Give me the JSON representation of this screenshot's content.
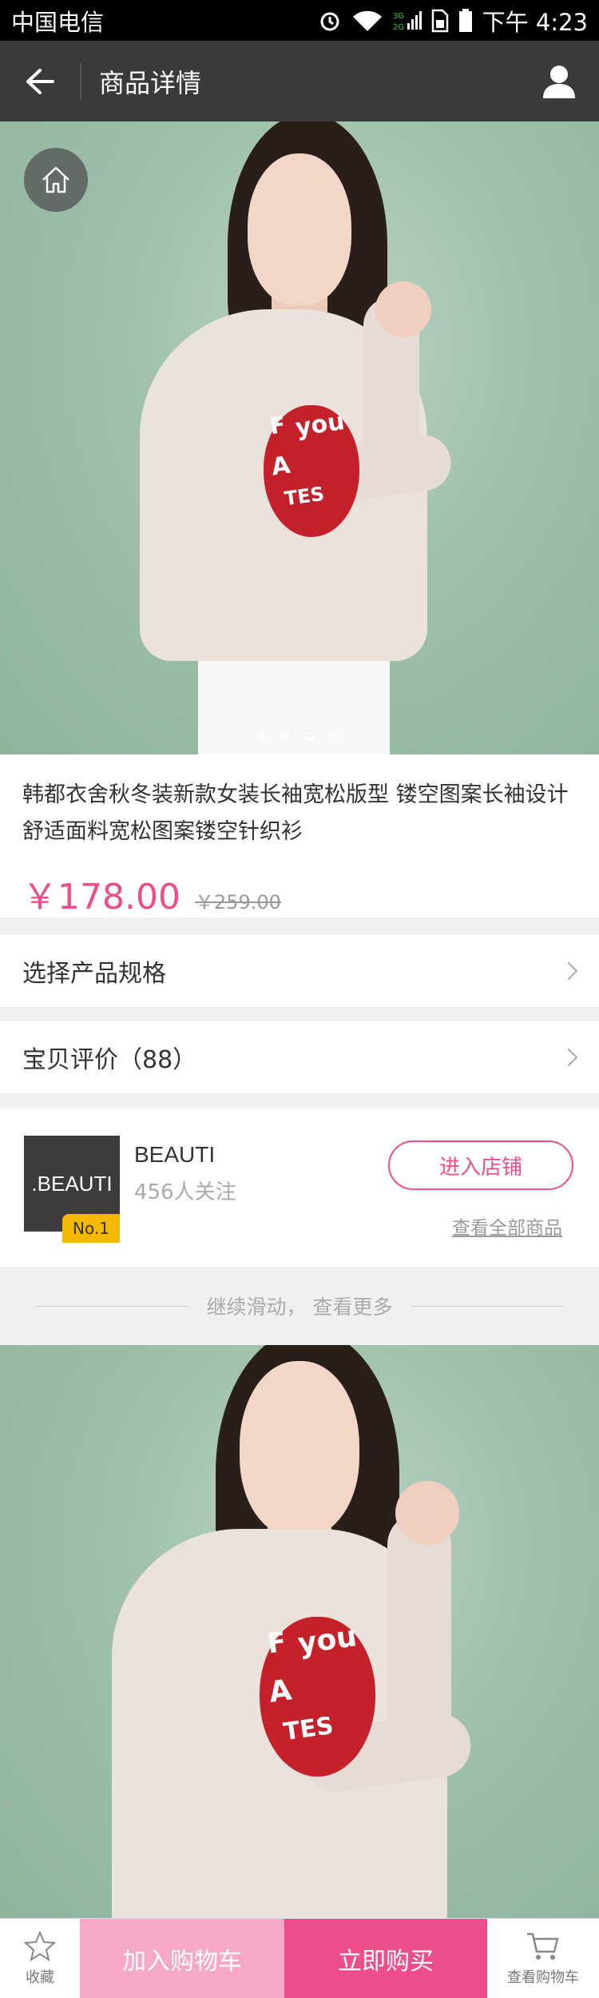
{
  "status_bar": {
    "carrier": "中国电信",
    "time": "下午 4:23",
    "icons": [
      "alarm-icon",
      "wifi-icon",
      "signal-icon",
      "sim-icon",
      "battery-icon"
    ]
  },
  "header": {
    "title": "商品详情",
    "back_icon": "arrow-left-icon",
    "user_icon": "user-icon"
  },
  "gallery": {
    "home_icon": "home-icon",
    "heart_text": [
      "F",
      "you",
      "A",
      "TES"
    ],
    "current_slide": 3,
    "total_slides": 4
  },
  "product": {
    "title": "韩都衣舍秋冬装新款女装长袖宽松版型 镂空图案长袖设计 舒适面料宽松图案镂空针织衫",
    "price": "￥178.00",
    "original_price": "￥259.00"
  },
  "rows": {
    "spec_label": "选择产品规格",
    "review_label": "宝贝评价（88）"
  },
  "shop": {
    "logo_text": ".BEAUTI",
    "badge": "No.1",
    "name": "BEAUTI",
    "followers": "456人关注",
    "enter_label": "进入店铺",
    "all_link": "查看全部商品"
  },
  "more": {
    "text": "继续滑动， 查看更多"
  },
  "bottom": {
    "favorite_label": "收藏",
    "add_cart_label": "加入购物车",
    "buy_label": "立即购买",
    "view_cart_label": "查看购物车"
  },
  "colors": {
    "accent": "#ee4d8c",
    "accent_light": "#f7a8c6",
    "header_bg": "#3a3a3a"
  }
}
